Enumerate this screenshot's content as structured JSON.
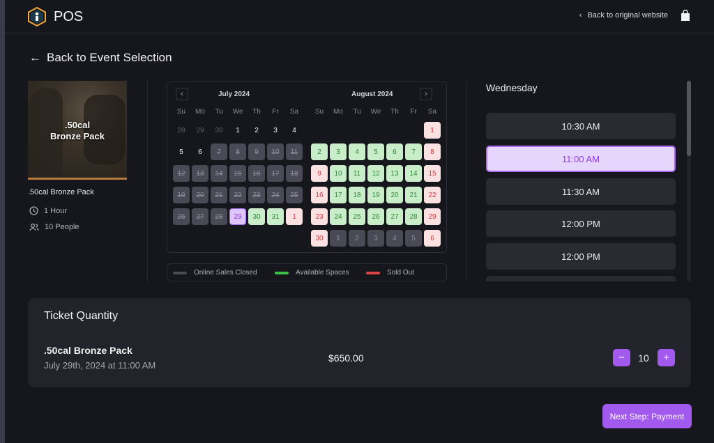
{
  "app": {
    "name": "POS",
    "back_site": "Back to original website"
  },
  "nav": {
    "back_event": "Back to Event Selection"
  },
  "event": {
    "image_text_line1": ".50cal",
    "image_text_line2": "Bronze Pack",
    "title": ".50cal Bronze Pack",
    "duration": "1 Hour",
    "people": "10 People"
  },
  "calendar": {
    "dow": [
      "Su",
      "Mo",
      "Tu",
      "We",
      "Th",
      "Fr",
      "Sa"
    ],
    "months": [
      {
        "title": "July 2024",
        "days": [
          {
            "label": "28",
            "state": "past"
          },
          {
            "label": "29",
            "state": "past"
          },
          {
            "label": "30",
            "state": "past"
          },
          {
            "label": "1",
            "state": "plain"
          },
          {
            "label": "2",
            "state": "plain"
          },
          {
            "label": "3",
            "state": "plain"
          },
          {
            "label": "4",
            "state": "plain"
          },
          {
            "label": "5",
            "state": "plain"
          },
          {
            "label": "6",
            "state": "plain"
          },
          {
            "label": "7",
            "state": "closed"
          },
          {
            "label": "8",
            "state": "closed"
          },
          {
            "label": "9",
            "state": "closed"
          },
          {
            "label": "10",
            "state": "closed"
          },
          {
            "label": "11",
            "state": "closed"
          },
          {
            "label": "12",
            "state": "closed"
          },
          {
            "label": "13",
            "state": "closed"
          },
          {
            "label": "14",
            "state": "closed"
          },
          {
            "label": "15",
            "state": "closed"
          },
          {
            "label": "16",
            "state": "closed"
          },
          {
            "label": "17",
            "state": "closed"
          },
          {
            "label": "18",
            "state": "closed"
          },
          {
            "label": "19",
            "state": "closed"
          },
          {
            "label": "20",
            "state": "closed"
          },
          {
            "label": "21",
            "state": "closed"
          },
          {
            "label": "22",
            "state": "closed"
          },
          {
            "label": "23",
            "state": "closed"
          },
          {
            "label": "24",
            "state": "closed"
          },
          {
            "label": "25",
            "state": "closed"
          },
          {
            "label": "26",
            "state": "closed"
          },
          {
            "label": "27",
            "state": "closed"
          },
          {
            "label": "28",
            "state": "closed"
          },
          {
            "label": "29",
            "state": "selected"
          },
          {
            "label": "30",
            "state": "avail"
          },
          {
            "label": "31",
            "state": "avail"
          },
          {
            "label": "1",
            "state": "sold"
          }
        ]
      },
      {
        "title": "August 2024",
        "days": [
          {
            "label": "",
            "state": "empty"
          },
          {
            "label": "",
            "state": "empty"
          },
          {
            "label": "",
            "state": "empty"
          },
          {
            "label": "",
            "state": "empty"
          },
          {
            "label": "",
            "state": "empty"
          },
          {
            "label": "",
            "state": "empty"
          },
          {
            "label": "1",
            "state": "sold"
          },
          {
            "label": "2",
            "state": "avail"
          },
          {
            "label": "3",
            "state": "avail"
          },
          {
            "label": "4",
            "state": "avail"
          },
          {
            "label": "5",
            "state": "avail"
          },
          {
            "label": "6",
            "state": "avail"
          },
          {
            "label": "7",
            "state": "avail"
          },
          {
            "label": "8",
            "state": "sold"
          },
          {
            "label": "9",
            "state": "sold"
          },
          {
            "label": "10",
            "state": "avail"
          },
          {
            "label": "11",
            "state": "avail"
          },
          {
            "label": "12",
            "state": "avail"
          },
          {
            "label": "13",
            "state": "avail"
          },
          {
            "label": "14",
            "state": "avail"
          },
          {
            "label": "15",
            "state": "sold"
          },
          {
            "label": "16",
            "state": "sold"
          },
          {
            "label": "17",
            "state": "avail"
          },
          {
            "label": "18",
            "state": "avail"
          },
          {
            "label": "19",
            "state": "avail"
          },
          {
            "label": "20",
            "state": "avail"
          },
          {
            "label": "21",
            "state": "avail"
          },
          {
            "label": "22",
            "state": "sold"
          },
          {
            "label": "23",
            "state": "sold"
          },
          {
            "label": "24",
            "state": "avail"
          },
          {
            "label": "25",
            "state": "avail"
          },
          {
            "label": "26",
            "state": "avail"
          },
          {
            "label": "27",
            "state": "avail"
          },
          {
            "label": "28",
            "state": "avail"
          },
          {
            "label": "29",
            "state": "sold"
          },
          {
            "label": "30",
            "state": "sold"
          },
          {
            "label": "1",
            "state": "next"
          },
          {
            "label": "2",
            "state": "next"
          },
          {
            "label": "3",
            "state": "next"
          },
          {
            "label": "4",
            "state": "next"
          },
          {
            "label": "5",
            "state": "next"
          },
          {
            "label": "6",
            "state": "sold"
          }
        ]
      }
    ],
    "legend": [
      {
        "label": "Online Sales Closed",
        "color": "#4a4a56"
      },
      {
        "label": "Available Spaces",
        "color": "#3fbf4a"
      },
      {
        "label": "Sold Out",
        "color": "#e04545"
      }
    ]
  },
  "timeslots": {
    "day_name": "Wednesday",
    "slots": [
      {
        "label": "10:30 AM",
        "active": false
      },
      {
        "label": "11:00 AM",
        "active": true
      },
      {
        "label": "11:30 AM",
        "active": false
      },
      {
        "label": "12:00 PM",
        "active": false
      },
      {
        "label": "12:00 PM",
        "active": false
      },
      {
        "label": "",
        "active": false
      }
    ]
  },
  "ticket": {
    "heading": "Ticket Quantity",
    "name": ".50cal Bronze Pack",
    "date": "July 29th, 2024 at 11:00 AM",
    "price": "$650.00",
    "quantity": "10",
    "minus": "−",
    "plus": "+"
  },
  "footer": {
    "next_label": "Next Step: Payment"
  },
  "colors": {
    "accent": "#a259ee",
    "available": "#c9ecc9",
    "sold_out": "#fbe1e1",
    "closed": "#4a4a56"
  }
}
